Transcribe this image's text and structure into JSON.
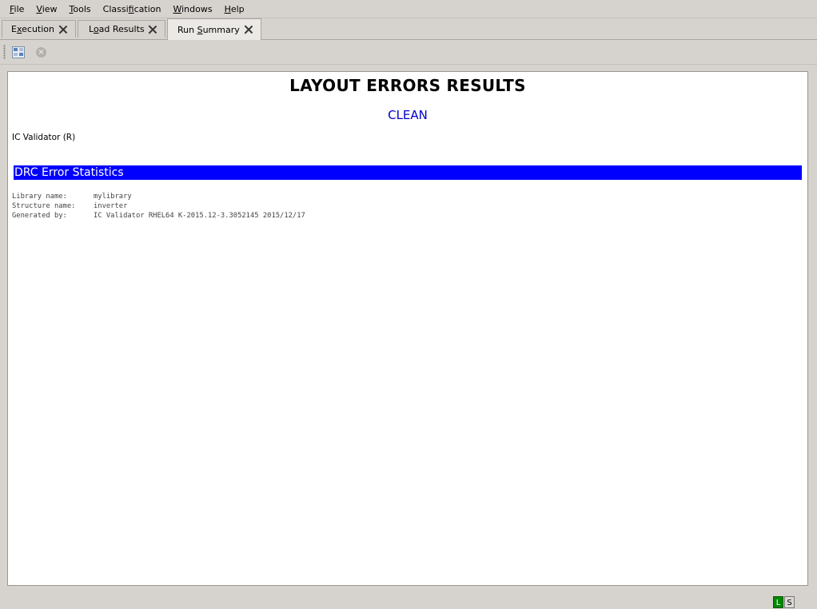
{
  "menubar": {
    "items": [
      {
        "mnemonic": "F",
        "rest": "ile"
      },
      {
        "mnemonic": "V",
        "rest": "iew"
      },
      {
        "mnemonic": "T",
        "rest": "ools"
      },
      {
        "prefix": "Classi",
        "mnemonic": "f",
        "rest": "ication"
      },
      {
        "mnemonic": "W",
        "rest": "indows"
      },
      {
        "mnemonic": "H",
        "rest": "elp"
      }
    ]
  },
  "tabs": [
    {
      "prefix": "E",
      "mnemonic": "x",
      "rest": "ecution",
      "active": false
    },
    {
      "prefix": "L",
      "mnemonic": "o",
      "rest": "ad Results",
      "active": false
    },
    {
      "prefix": "Run ",
      "mnemonic": "S",
      "rest": "ummary",
      "active": true
    }
  ],
  "toolbar": {
    "icons": [
      "grid-view-icon",
      "stop-icon"
    ]
  },
  "report": {
    "title": "LAYOUT ERRORS RESULTS",
    "status": "CLEAN",
    "status_color": "#0000cc",
    "tool": "IC Validator (R)",
    "section_title": "DRC Error Statistics",
    "section_color": "#0000ff",
    "info": [
      {
        "label": "Library name:",
        "value": "mylibrary"
      },
      {
        "label": "Structure name:",
        "value": "inverter"
      },
      {
        "label": "Generated by:",
        "value": "IC Validator RHEL64 K-2015.12-3.3052145 2015/12/17"
      }
    ]
  },
  "statusbar": {
    "indicators": [
      {
        "label": "L",
        "color": "#008800"
      },
      {
        "label": "S",
        "color": "#dcdad6"
      }
    ]
  }
}
